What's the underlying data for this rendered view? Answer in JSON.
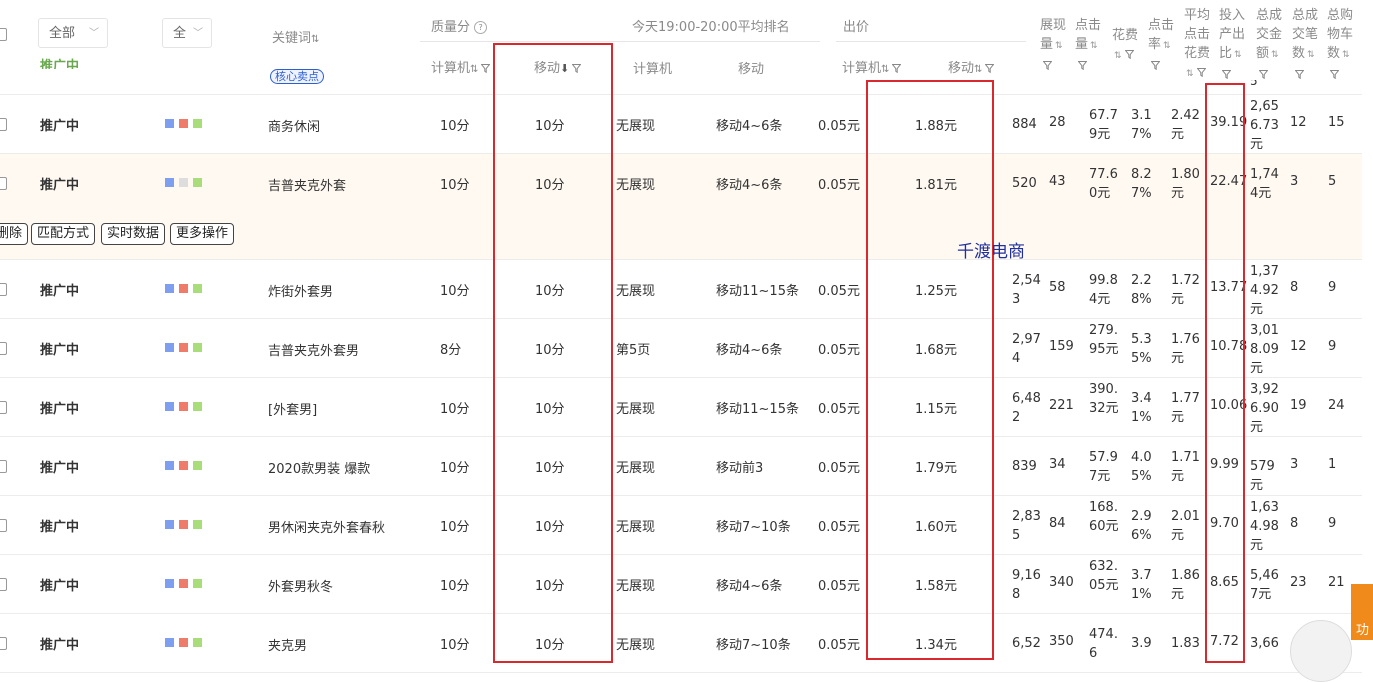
{
  "filters": {
    "status_select": "全部",
    "device_select": "全"
  },
  "headers": {
    "keyword": "关键词",
    "quality": "质量分",
    "quality_pc": "计算机",
    "quality_mobile": "移动",
    "rank_group": "今天19:00-20:00平均排名",
    "rank_pc": "计算机",
    "rank_mobile": "移动",
    "bid": "出价",
    "bid_pc": "计算机",
    "bid_mobile": "移动",
    "impressions": "展现量",
    "clicks": "点击量",
    "cost": "花费",
    "ctr": "点击率",
    "avg_cpc": "平均点击花费",
    "roi": "投入产出比",
    "gmv": "总成交金额",
    "orders": "总成交笔数",
    "cart": "总购物车数"
  },
  "partial_top_row": {
    "status": "推广中",
    "tag": "核心卖点",
    "roi_tail": "5"
  },
  "rows": [
    {
      "status": "推广中",
      "keyword": "商务休闲",
      "q_pc": "10分",
      "q_m": "10分",
      "r_pc": "无展现",
      "r_m": "移动4~6条",
      "b_pc": "0.05元",
      "b_m": "1.88元",
      "imp": "884",
      "clk": "28",
      "cost": "67.79元",
      "ctr": "3.17%",
      "cpc": "2.42元",
      "roi": "39.19",
      "gmv": "2,656.73元",
      "orders": "12",
      "cart": "15",
      "colors": [
        "#7e9ef0",
        "#ef7b6a",
        "#a8dd7a"
      ]
    },
    {
      "status": "推广中",
      "keyword": "吉普夹克外套",
      "q_pc": "10分",
      "q_m": "10分",
      "r_pc": "无展现",
      "r_m": "移动4~6条",
      "b_pc": "0.05元",
      "b_m": "1.81元",
      "imp": "520",
      "clk": "43",
      "cost": "77.60元",
      "ctr": "8.27%",
      "cpc": "1.80元",
      "roi": "22.47",
      "gmv": "1,744元",
      "orders": "3",
      "cart": "5",
      "colors": [
        "#7e9ef0",
        "#dddddd",
        "#a8dd7a"
      ]
    },
    {
      "status": "推广中",
      "keyword": "炸街外套男",
      "q_pc": "10分",
      "q_m": "10分",
      "r_pc": "无展现",
      "r_m": "移动11~15条",
      "b_pc": "0.05元",
      "b_m": "1.25元",
      "imp": "2,543",
      "clk": "58",
      "cost": "99.84元",
      "ctr": "2.28%",
      "cpc": "1.72元",
      "roi": "13.77",
      "gmv": "1,374.92元",
      "orders": "8",
      "cart": "9",
      "colors": [
        "#7e9ef0",
        "#ef7b6a",
        "#a8dd7a"
      ]
    },
    {
      "status": "推广中",
      "keyword": "吉普夹克外套男",
      "q_pc": "8分",
      "q_m": "10分",
      "r_pc": "第5页",
      "r_m": "移动4~6条",
      "b_pc": "0.05元",
      "b_m": "1.68元",
      "imp": "2,974",
      "clk": "159",
      "cost": "279.95元",
      "ctr": "5.35%",
      "cpc": "1.76元",
      "roi": "10.78",
      "gmv": "3,018.09元",
      "orders": "12",
      "cart": "9",
      "colors": [
        "#7e9ef0",
        "#ef7b6a",
        "#a8dd7a"
      ]
    },
    {
      "status": "推广中",
      "keyword": "[外套男]",
      "q_pc": "10分",
      "q_m": "10分",
      "r_pc": "无展现",
      "r_m": "移动11~15条",
      "b_pc": "0.05元",
      "b_m": "1.15元",
      "imp": "6,482",
      "clk": "221",
      "cost": "390.32元",
      "ctr": "3.41%",
      "cpc": "1.77元",
      "roi": "10.06",
      "gmv": "3,926.90元",
      "orders": "19",
      "cart": "24",
      "colors": [
        "#7e9ef0",
        "#ef7b6a",
        "#a8dd7a"
      ]
    },
    {
      "status": "推广中",
      "keyword": "2020款男装 爆款",
      "q_pc": "10分",
      "q_m": "10分",
      "r_pc": "无展现",
      "r_m": "移动前3",
      "b_pc": "0.05元",
      "b_m": "1.79元",
      "imp": "839",
      "clk": "34",
      "cost": "57.97元",
      "ctr": "4.05%",
      "cpc": "1.71元",
      "roi": "9.99",
      "gmv": "579元",
      "orders": "3",
      "cart": "1",
      "colors": [
        "#7e9ef0",
        "#ef7b6a",
        "#a8dd7a"
      ]
    },
    {
      "status": "推广中",
      "keyword": "男休闲夹克外套春秋",
      "q_pc": "10分",
      "q_m": "10分",
      "r_pc": "无展现",
      "r_m": "移动7~10条",
      "b_pc": "0.05元",
      "b_m": "1.60元",
      "imp": "2,835",
      "clk": "84",
      "cost": "168.60元",
      "ctr": "2.96%",
      "cpc": "2.01元",
      "roi": "9.70",
      "gmv": "1,634.98元",
      "orders": "8",
      "cart": "9",
      "colors": [
        "#7e9ef0",
        "#ef7b6a",
        "#a8dd7a"
      ]
    },
    {
      "status": "推广中",
      "keyword": "外套男秋冬",
      "q_pc": "10分",
      "q_m": "10分",
      "r_pc": "无展现",
      "r_m": "移动4~6条",
      "b_pc": "0.05元",
      "b_m": "1.58元",
      "imp": "9,168",
      "clk": "340",
      "cost": "632.05元",
      "ctr": "3.71%",
      "cpc": "1.86元",
      "roi": "8.65",
      "gmv": "5,467元",
      "orders": "23",
      "cart": "21",
      "colors": [
        "#7e9ef0",
        "#ef7b6a",
        "#a8dd7a"
      ]
    },
    {
      "status": "推广中",
      "keyword": "夹克男",
      "q_pc": "10分",
      "q_m": "10分",
      "r_pc": "无展现",
      "r_m": "移动7~10条",
      "b_pc": "0.05元",
      "b_m": "1.34元",
      "imp": "6,52",
      "clk": "350",
      "cost": "474.6",
      "ctr": "3.9",
      "cpc": "1.83",
      "roi": "7.72",
      "gmv": "3,66",
      "orders": "",
      "cart": "",
      "colors": [
        "#7e9ef0",
        "#ef7b6a",
        "#a8dd7a"
      ]
    }
  ],
  "action_bar": {
    "delete": "删除",
    "match": "匹配方式",
    "realtime": "实时数据",
    "more": "更多操作"
  },
  "watermark": "千渡电商",
  "float_button": "功"
}
